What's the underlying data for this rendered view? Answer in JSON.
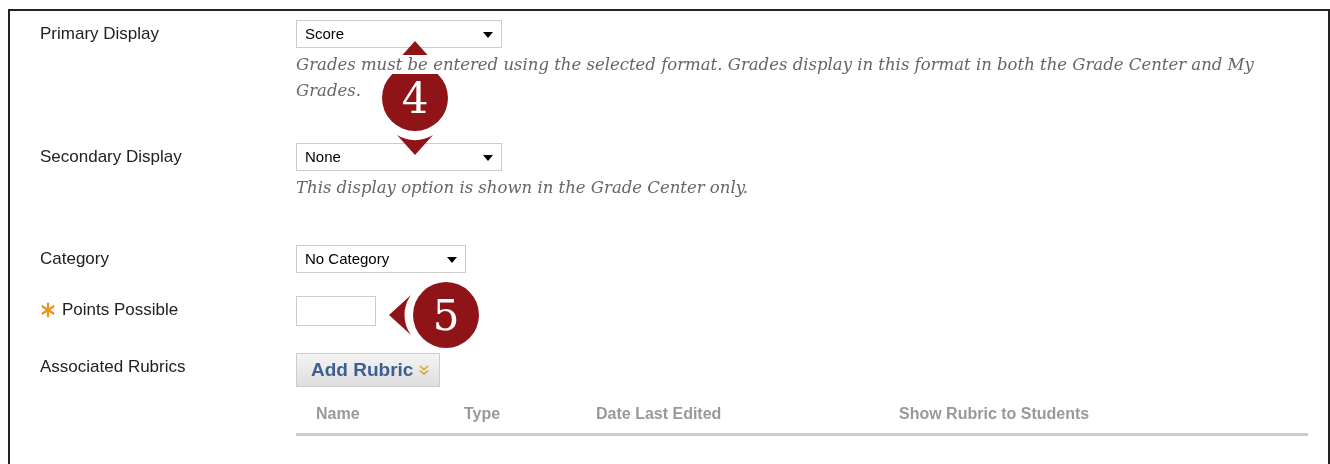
{
  "fields": [
    {
      "kind": "select",
      "label": "Primary Display",
      "required": false,
      "value": "Score",
      "hint": "Grades must be entered using the selected format. Grades display in this format in both the Grade Center and My Grades."
    },
    {
      "kind": "select",
      "label": "Secondary Display",
      "required": false,
      "value": "None",
      "hint": "This display option is shown in the Grade Center only."
    },
    {
      "kind": "select",
      "label": "Category",
      "required": false,
      "value": "No Category"
    },
    {
      "kind": "text",
      "label": "Points Possible",
      "required": true
    },
    {
      "kind": "button",
      "label": "Associated Rubrics",
      "required": false,
      "button": "Add Rubric",
      "columns": [
        "Name",
        "Type",
        "Date Last Edited",
        "Show Rubric to Students"
      ]
    }
  ],
  "callouts": [
    {
      "number": "4",
      "kind": "vertical"
    },
    {
      "number": "5",
      "kind": "left"
    }
  ]
}
